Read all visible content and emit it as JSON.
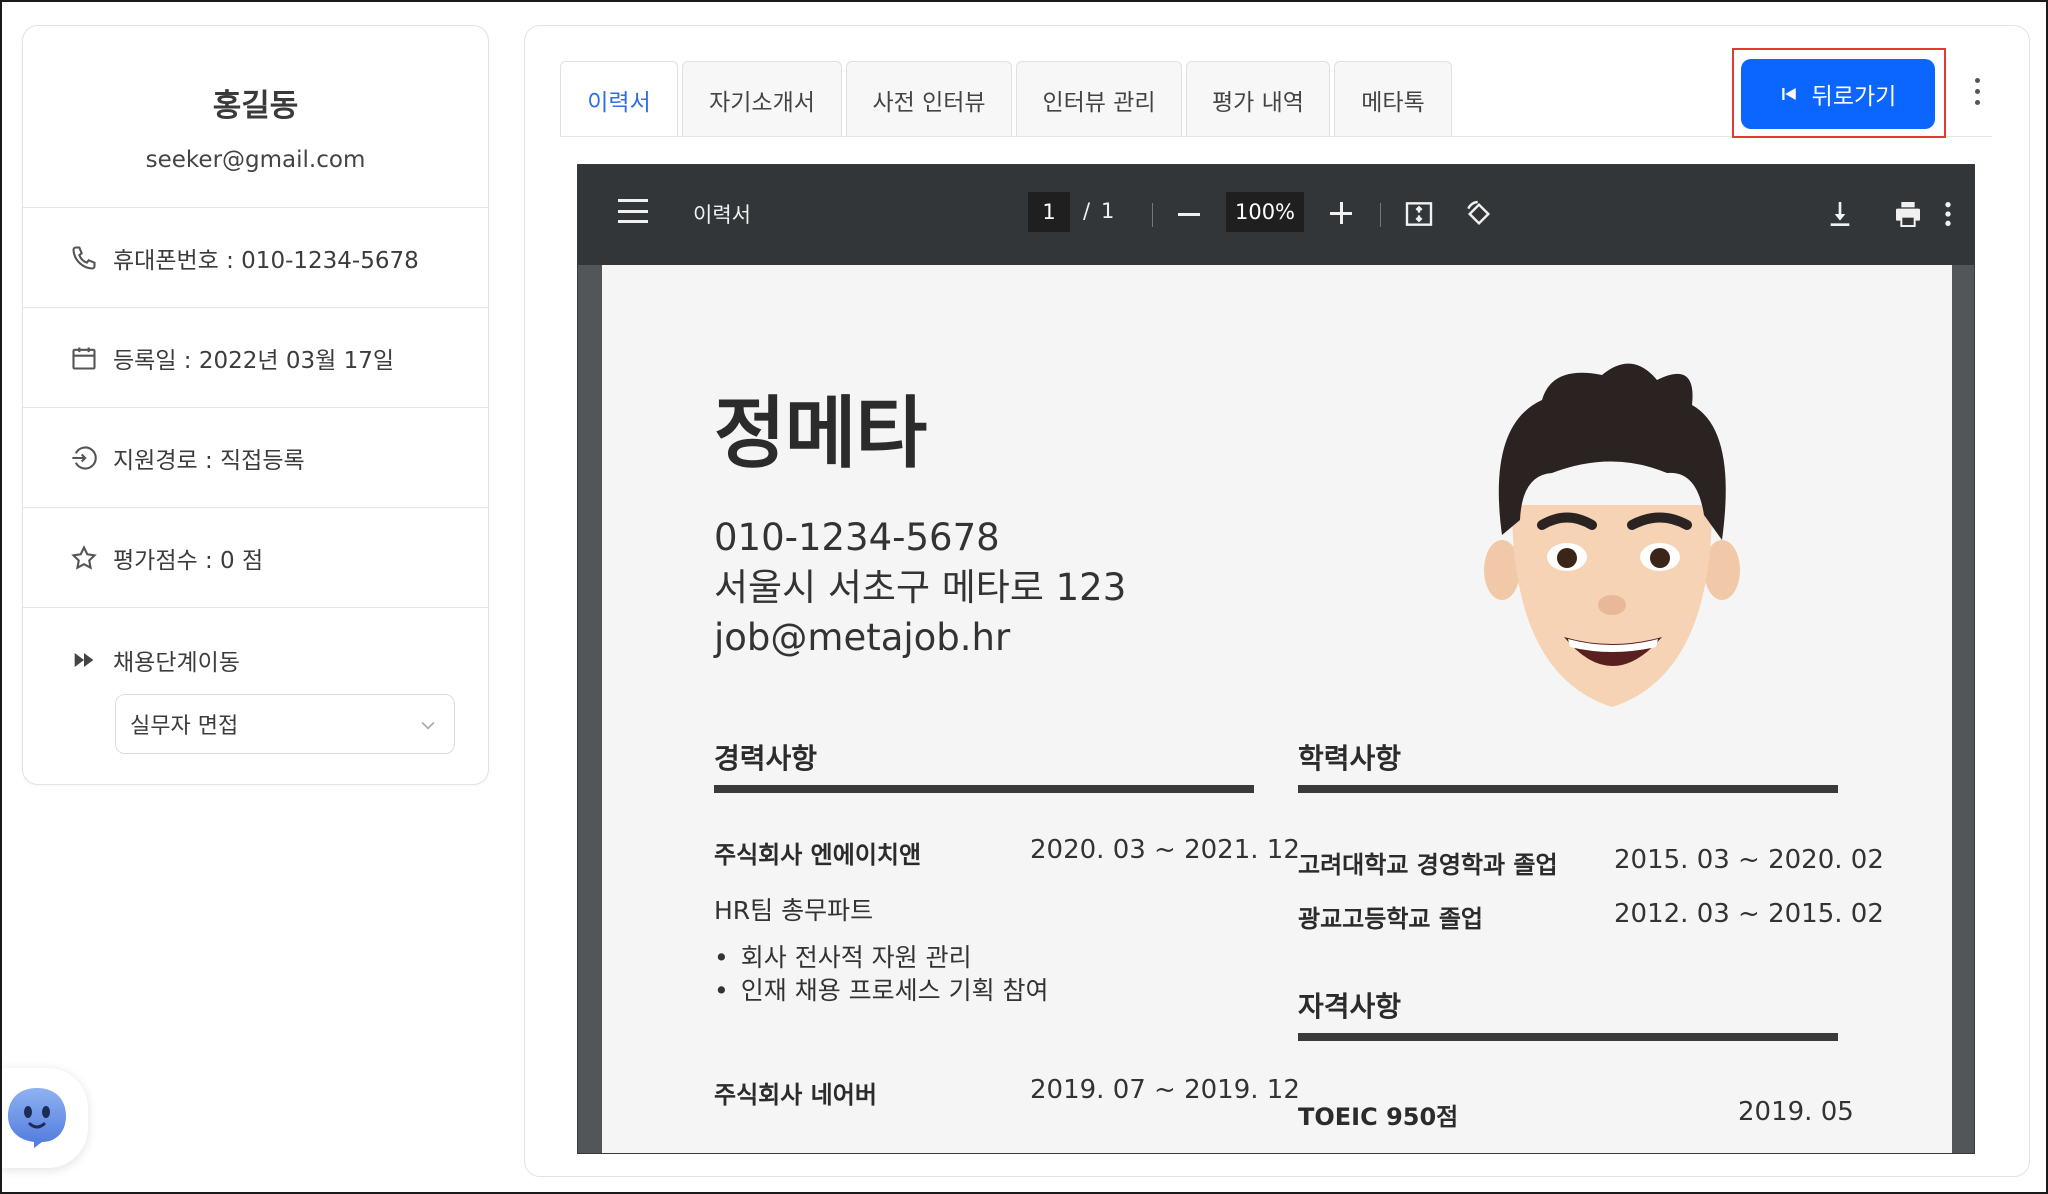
{
  "profile": {
    "name": "홍길동",
    "email": "seeker@gmail.com",
    "phone": "휴대폰번호 : 010-1234-5678",
    "registered": "등록일 : 2022년 03월 17일",
    "source": "지원경로 : 직접등록",
    "score": "평가점수 : 0 점",
    "stage_label": "채용단계이동",
    "stage_value": "실무자 면접"
  },
  "tabs": [
    {
      "label": "이력서",
      "active": true
    },
    {
      "label": "자기소개서"
    },
    {
      "label": "사전 인터뷰"
    },
    {
      "label": "인터뷰 관리"
    },
    {
      "label": "평가 내역"
    },
    {
      "label": "메타톡"
    }
  ],
  "back_button": "뒤로가기",
  "viewer": {
    "title": "이력서",
    "page": "1",
    "slash": "/",
    "total": "1",
    "zoom": "100%"
  },
  "resume": {
    "name": "정메타",
    "phone": "010-1234-5678",
    "address": "서울시 서초구 메타로 123",
    "email": "job@metajob.hr",
    "career_title": "경력사항",
    "career": [
      {
        "company": "주식회사 엔에이치앤",
        "period": "2020. 03 ~ 2021. 12",
        "team": "HR팀 총무파트",
        "duties": [
          "회사 전사적 자원 관리",
          "인재 채용 프로세스 기획 참여"
        ]
      },
      {
        "company": "주식회사 네어버",
        "period": "2019. 07 ~ 2019. 12"
      }
    ],
    "education_title": "학력사항",
    "education": [
      {
        "school": "고려대학교 경영학과 졸업",
        "period": "2015. 03 ~ 2020. 02"
      },
      {
        "school": "광교고등학교 졸업",
        "period": "2012. 03 ~ 2015. 02"
      }
    ],
    "cert_title": "자격사항",
    "certs": [
      {
        "name": "TOEIC  950점",
        "date": "2019. 05"
      }
    ]
  },
  "colors": {
    "accent": "#0b66ff",
    "active_tab": "#2f6ee6",
    "highlight": "#e53935",
    "viewer_bar": "#323639"
  }
}
